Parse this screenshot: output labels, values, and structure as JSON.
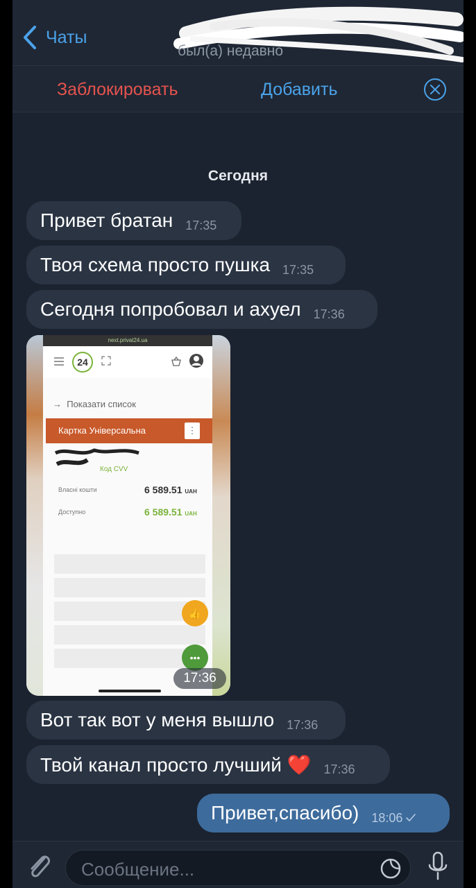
{
  "header": {
    "back_label": "Чаты",
    "status": "был(а) недавно"
  },
  "actions": {
    "block_label": "Заблокировать",
    "add_label": "Добавить"
  },
  "chat": {
    "date_separator": "Сегодня",
    "messages": [
      {
        "text": "Привет братан",
        "time": "17:35"
      },
      {
        "text": "Твоя схема просто пушка",
        "time": "17:35"
      },
      {
        "text": "Сегодня попробовал и ахуел",
        "time": "17:36"
      },
      {
        "text": "Вот так вот у меня вышло",
        "time": "17:36"
      },
      {
        "text": "Твой канал просто лучший ❤️",
        "time": "17:36"
      }
    ],
    "photo": {
      "time": "17:36",
      "url": "next.privat24.ua",
      "logo": "24",
      "show_list": "Показати список",
      "card_title": "Картка Універсальна",
      "card_menu": "⋮",
      "cvv_label": "Код CVV",
      "own_funds_label": "Власні кошти",
      "own_funds_value": "6 589.51",
      "available_label": "Доступно",
      "available_value": "6 589.51",
      "currency": "UAH"
    },
    "outgoing": {
      "text": "Привет,спасибо)",
      "time": "18:06",
      "status_icon": "check-icon"
    }
  },
  "composer": {
    "placeholder": "Сообщение..."
  },
  "colors": {
    "accent": "#4ba3ea",
    "danger": "#e5534e",
    "background": "#1b2330",
    "bubble_in": "#2a3443",
    "bubble_out": "#3d6b9c"
  }
}
